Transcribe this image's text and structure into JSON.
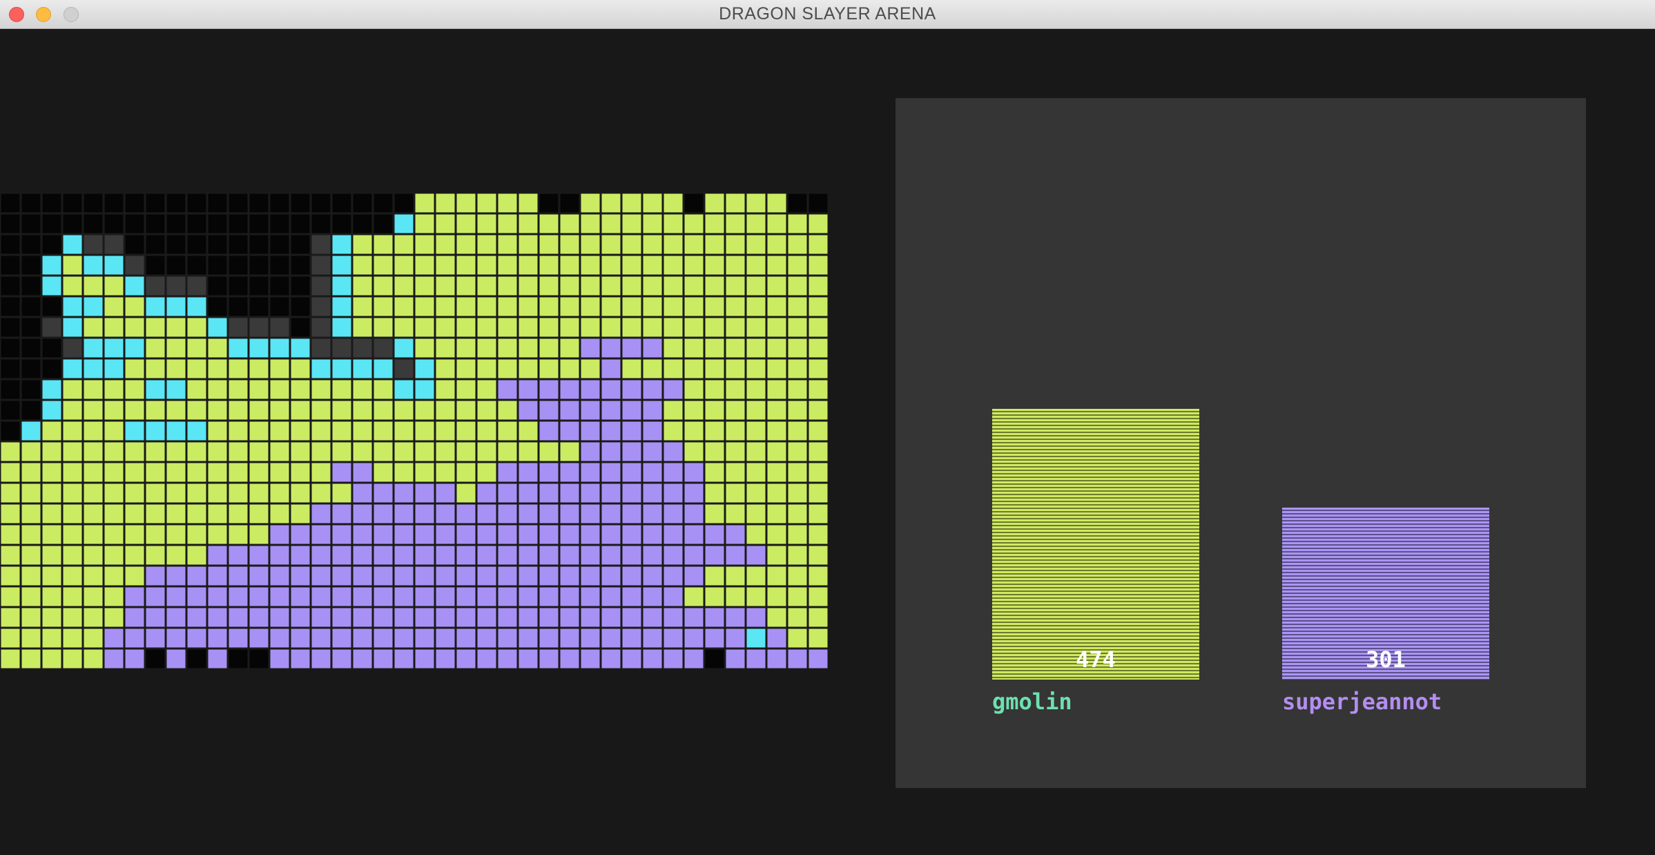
{
  "window": {
    "title": "DRAGON SLAYER ARENA"
  },
  "colors": {
    "empty": "#050505",
    "wall": "#3a3a3a",
    "green": "#cbec62",
    "purple": "#a891f4",
    "cyan": "#5ae6f4",
    "grid_line": "#1a1a1a"
  },
  "board": {
    "legend": {
      ".": "empty",
      "#": "wall",
      "G": "green",
      "P": "purple",
      "C": "cyan"
    },
    "rows": [
      "....................GGGGGG..GGGGG.GGGG...",
      "...................CGGGGGGGGGGGGGGGGGGGGG",
      "...C##.........#CGGGGGGGGGGGGGGGGGGGGGGG",
      "..CGCC#........#CGGGGGGGGGGGGGGGGGGGGGGG",
      "..CGGGC###.....#CGGGGGGGGGGGGGGGGGGGGGGG",
      "...CCGGCCC.....#CGGGGGGGGGGGGGGGGGGGGGGG",
      "..#CGGGGGGC###.#CGGGGGGGGGGGGGGGGGGGGGGG",
      "...#CCCGGGGCCCC####CGGGGGGGGPPPPGGGGGGGGG",
      "...CCCGGGGGGGGGCCCC#CGGGGGGGGPGGGGGGGGGGGG",
      "..CGGGGCCGGGGGGGGGGCCGGGPPPPPPPPPGGGGGGGG",
      "..CGGGGGGGGGGGGGGGGGGGGGGPPPPPPPGGGGGGGG",
      ".CGGGGCCCCGGGGGGGGGGGGGGGGPPPPPPGGGGGGGG",
      "GGGGGGGGGGGGGGGGGGGGGGGGGGGGPPPPPGGGGGGGG",
      "GGGGGGGGGGGGGGGGPPGGGGGGPPPPPPPPPPGGGGGGG",
      "GGGGGGGGGGGGGGGGGPPPPPGPPPPPPPPPPPGGGGGGG",
      "GGGGGGGGGGGGGGGPPPPPPPPPPPPPPPPPPPGGGGGGG",
      "GGGGGGGGGGGGGPPPPPPPPPPPPPPPPPPPPPPPGGGGG",
      "GGGGGGGGGGPPPPPPPPPPPPPPPPPPPPPPPPPPPGGGG",
      "GGGGGGGPPPPPPPPPPPPPPPPPPPPPPPPPPPGGGGGGG",
      "GGGGGGPPPPPPPPPPPPPPPPPPPPPPPPPPPGGGGGGGG",
      "GGGGGGPPPPPPPPPPPPPPPPPPPPPPPPPPPPPPPGGGG",
      "GGGGGPPPPPPPPPPPPPPPPPPPPPPPPPPPPPPPCPGGG",
      "GGGGGPP.P.P..PPPPPPPPPPPPPPPPPPPPP.PPPPPP"
    ]
  },
  "scoreboard": {
    "max_score": 474,
    "players": [
      {
        "name": "gmolin",
        "score": "474",
        "value": 474,
        "color": "green"
      },
      {
        "name": "superjeannot",
        "score": "301",
        "value": 301,
        "color": "purple"
      }
    ]
  }
}
